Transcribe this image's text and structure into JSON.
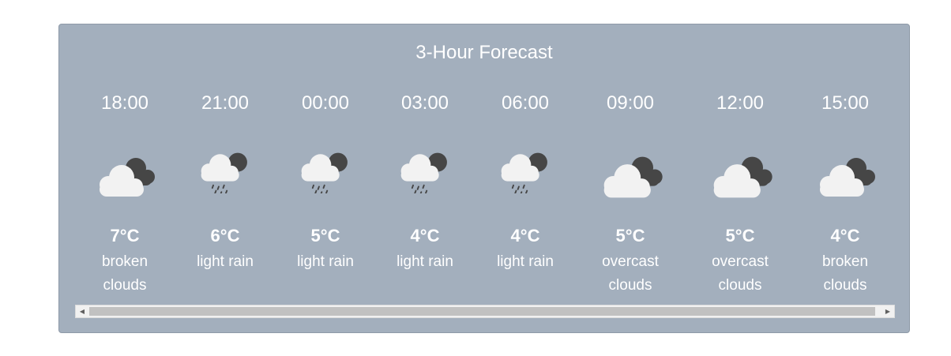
{
  "forecast": {
    "title": "3-Hour Forecast",
    "items": [
      {
        "time": "18:00",
        "icon": "broken-clouds-icon",
        "temp": "7°C",
        "desc": "broken clouds"
      },
      {
        "time": "21:00",
        "icon": "light-rain-icon",
        "temp": "6°C",
        "desc": "light rain"
      },
      {
        "time": "00:00",
        "icon": "light-rain-icon",
        "temp": "5°C",
        "desc": "light rain"
      },
      {
        "time": "03:00",
        "icon": "light-rain-icon",
        "temp": "4°C",
        "desc": "light rain"
      },
      {
        "time": "06:00",
        "icon": "light-rain-icon",
        "temp": "4°C",
        "desc": "light rain"
      },
      {
        "time": "09:00",
        "icon": "overcast-clouds-icon",
        "temp": "5°C",
        "desc": "overcast clouds"
      },
      {
        "time": "12:00",
        "icon": "overcast-clouds-icon",
        "temp": "5°C",
        "desc": "overcast clouds"
      },
      {
        "time": "15:00",
        "icon": "broken-clouds-icon",
        "temp": "4°C",
        "desc": "broken clouds"
      }
    ]
  },
  "scrollbar": {
    "left_arrow": "◀",
    "right_arrow": "▶"
  }
}
